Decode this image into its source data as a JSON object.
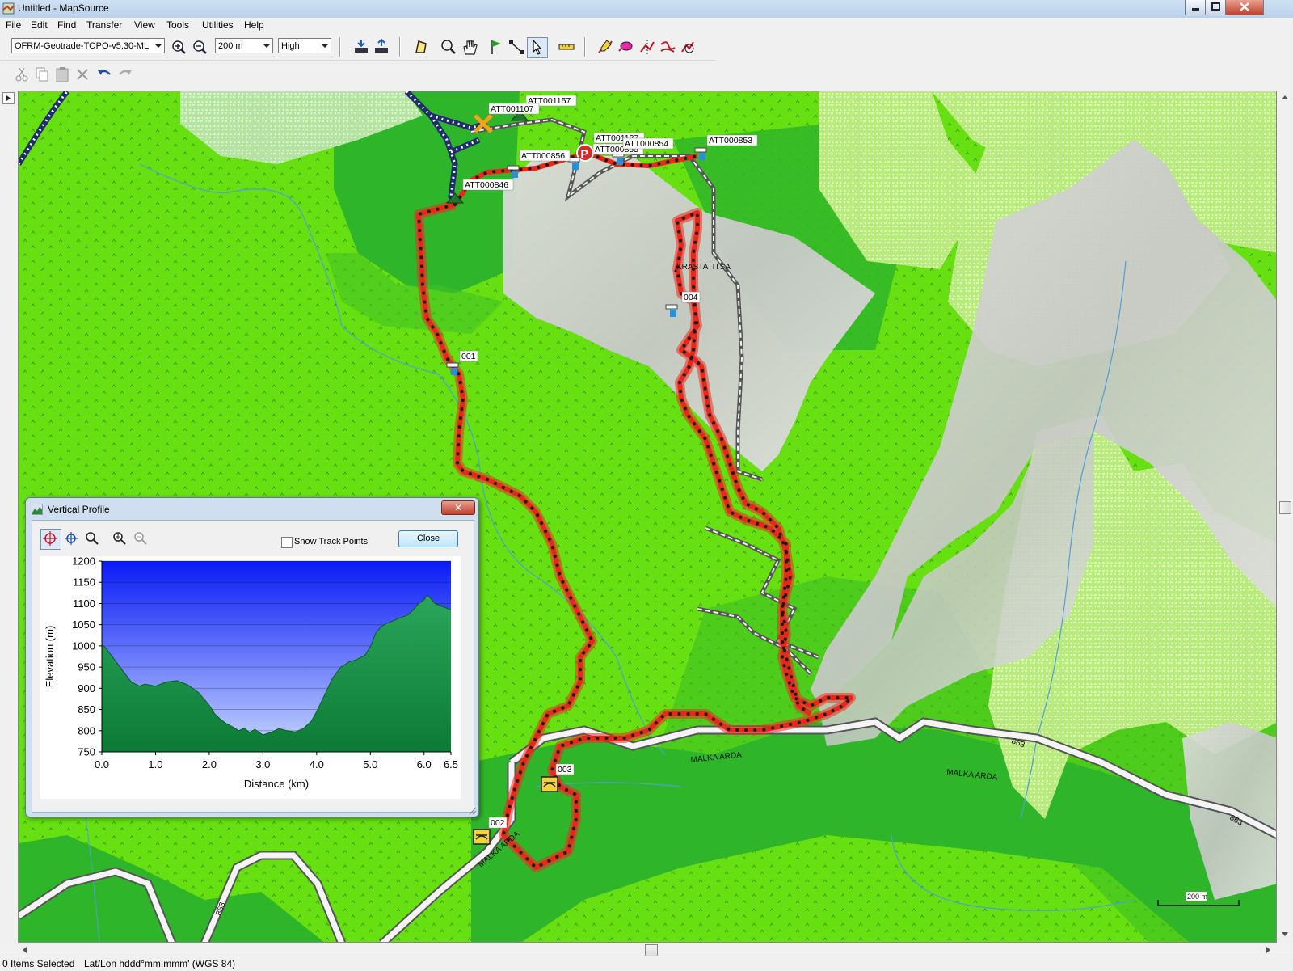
{
  "window": {
    "title": "Untitled - MapSource"
  },
  "menu": [
    "File",
    "Edit",
    "Find",
    "Transfer",
    "View",
    "Tools",
    "Utilities",
    "Help"
  ],
  "toolbar": {
    "map_product": "OFRM-Geotrade-TOPO-v5.30-ML",
    "zoom_level": "200 m",
    "detail": "High"
  },
  "map": {
    "waypoints": [
      "ATT001157",
      "ATT001107",
      "ATT000856",
      "ATT001127",
      "ATT000855",
      "ATT000854",
      "ATT000853",
      "ATT000846",
      "001",
      "002",
      "003",
      "004"
    ],
    "place_labels": [
      "KRASTATITSA",
      "MALKA ARDA",
      "MALKA ARDA",
      "MALKA ARDA"
    ],
    "road_numbers": [
      "863",
      "863",
      "863"
    ],
    "scale": "200 m"
  },
  "vertical_profile": {
    "title": "Vertical Profile",
    "show_track_points_label": "Show Track Points",
    "show_track_points": false,
    "close_label": "Close",
    "close_x": "✕"
  },
  "chart_data": {
    "type": "area",
    "xlabel": "Distance  (km)",
    "ylabel": "Elevation (m)",
    "xlim": [
      0,
      6.5
    ],
    "ylim": [
      750,
      1200
    ],
    "x_ticks": [
      "0.0",
      "1.0",
      "2.0",
      "3.0",
      "4.0",
      "5.0",
      "6.0",
      "6.5"
    ],
    "y_ticks": [
      "1200",
      "1150",
      "1100",
      "1050",
      "1000",
      "950",
      "900",
      "850",
      "800",
      "750"
    ],
    "series": [
      {
        "x": [
          0.0,
          0.1,
          0.25,
          0.4,
          0.55,
          0.7,
          0.8,
          1.0,
          1.2,
          1.4,
          1.6,
          1.8,
          1.9,
          2.0,
          2.1,
          2.2,
          2.3,
          2.45,
          2.55,
          2.65,
          2.75,
          2.85,
          3.0,
          3.15,
          3.3,
          3.45,
          3.6,
          3.75,
          3.9,
          4.0,
          4.15,
          4.3,
          4.45,
          4.6,
          4.75,
          4.9,
          5.0,
          5.1,
          5.2,
          5.3,
          5.4,
          5.5,
          5.6,
          5.7,
          5.8,
          5.9,
          6.0,
          6.05,
          6.1,
          6.2,
          6.3,
          6.4,
          6.5
        ],
        "y": [
          1005,
          990,
          965,
          940,
          915,
          905,
          910,
          905,
          915,
          918,
          908,
          890,
          875,
          860,
          840,
          828,
          818,
          808,
          800,
          806,
          796,
          803,
          790,
          796,
          805,
          800,
          797,
          805,
          822,
          845,
          885,
          925,
          950,
          962,
          968,
          978,
          998,
          1030,
          1045,
          1053,
          1058,
          1063,
          1068,
          1073,
          1085,
          1100,
          1108,
          1120,
          1115,
          1100,
          1095,
          1090,
          1085
        ]
      }
    ],
    "grid": true,
    "background": "blue gradient sky",
    "fill_color": "#1f9b4b"
  }
}
